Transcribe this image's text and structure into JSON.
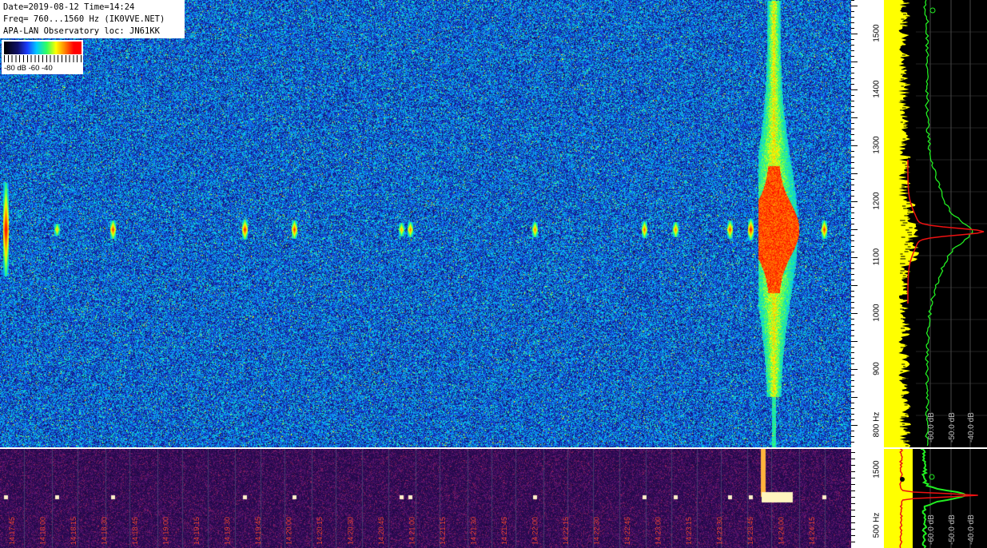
{
  "info": {
    "line1": "Date=2019-08-12 Time=14:24",
    "line2": "Freq= 760...1560 Hz (IK0VVE.NET)",
    "line3": "APA-LAN Observatory loc: JN61KK"
  },
  "colorscale": {
    "labels": "-80 dB -60      -40"
  },
  "colors": {
    "background": "#000000",
    "spectrum_fill": "#ffff00",
    "spectrum_avg": "#22ee22",
    "spectrum_peak": "#ee1111",
    "waterfall_bottom_bg": "#2a0a4a"
  },
  "chart_data": [
    {
      "type": "heatmap",
      "title": "",
      "yaxis": {
        "ticks": [
          {
            "value": 1500,
            "label": "1500"
          },
          {
            "value": 1400,
            "label": "1400"
          },
          {
            "value": 1300,
            "label": "1300"
          },
          {
            "value": 1200,
            "label": "1200"
          },
          {
            "value": 1100,
            "label": "1100"
          },
          {
            "value": 1000,
            "label": "1000"
          },
          {
            "value": 900,
            "label": "900"
          },
          {
            "value": 800,
            "label": "800 Hz"
          }
        ],
        "range": [
          760,
          1560
        ]
      },
      "dynamic_range_db": [
        -80,
        -40
      ],
      "carrier_hz": 1150
    },
    {
      "type": "line",
      "xlabels": [
        "-60.0 dB",
        "-50.0 dB",
        "-40.0 dB"
      ],
      "series": []
    },
    {
      "type": "heatmap",
      "yaxis": {
        "ticks": [
          {
            "value": 1500,
            "label": "1500"
          },
          {
            "value": 500,
            "label": "500 Hz"
          }
        ]
      },
      "time_labels": [
        "14:17:45",
        "14:18:00",
        "14:18:15",
        "14:18:30",
        "14:18:45",
        "14:19:00",
        "14:19:15",
        "14:19:30",
        "14:19:45",
        "14:20:00",
        "14:20:15",
        "14:20:30",
        "14:20:45",
        "14:21:00",
        "14:21:15",
        "14:21:30",
        "14:21:45",
        "14:22:00",
        "14:22:15",
        "14:22:30",
        "14:22:45",
        "14:23:00",
        "14:23:15",
        "14:23:30",
        "14:23:45",
        "14:24:00",
        "14:24:15"
      ]
    },
    {
      "type": "line",
      "xlabels": [
        "-60.0 dB",
        "-50.0 dB",
        "-40.0 dB"
      ],
      "series": []
    }
  ]
}
